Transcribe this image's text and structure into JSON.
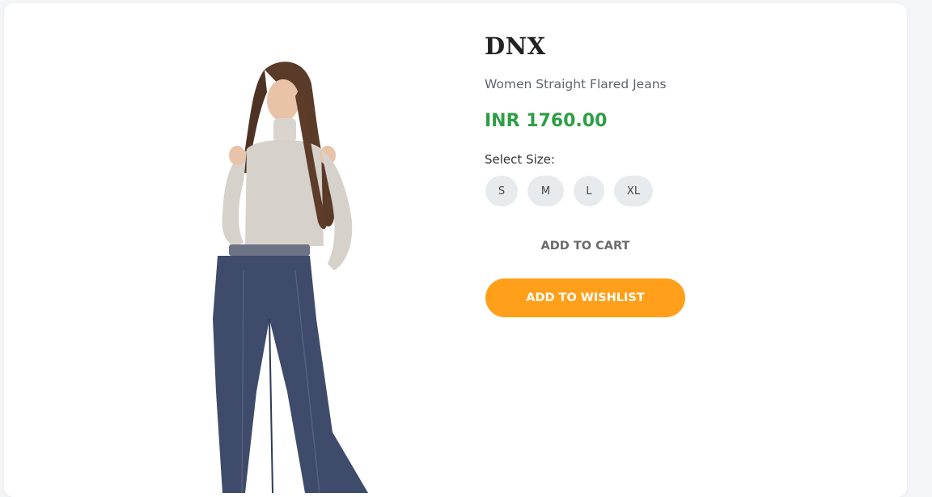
{
  "product": {
    "brand": "DNX",
    "name": "Women Straight Flared Jeans",
    "price": "INR 1760.00",
    "image_alt": "Model wearing light grey cold-shoulder top and dark blue flared jeans"
  },
  "size_selector": {
    "label": "Select Size:",
    "options": [
      "S",
      "M",
      "L",
      "XL"
    ]
  },
  "actions": {
    "add_to_cart": "ADD TO CART",
    "add_to_wishlist": "ADD TO WISHLIST"
  },
  "colors": {
    "price": "#2e9e45",
    "wishlist_button": "#ff9f1a",
    "size_chip": "#e8ebee"
  }
}
